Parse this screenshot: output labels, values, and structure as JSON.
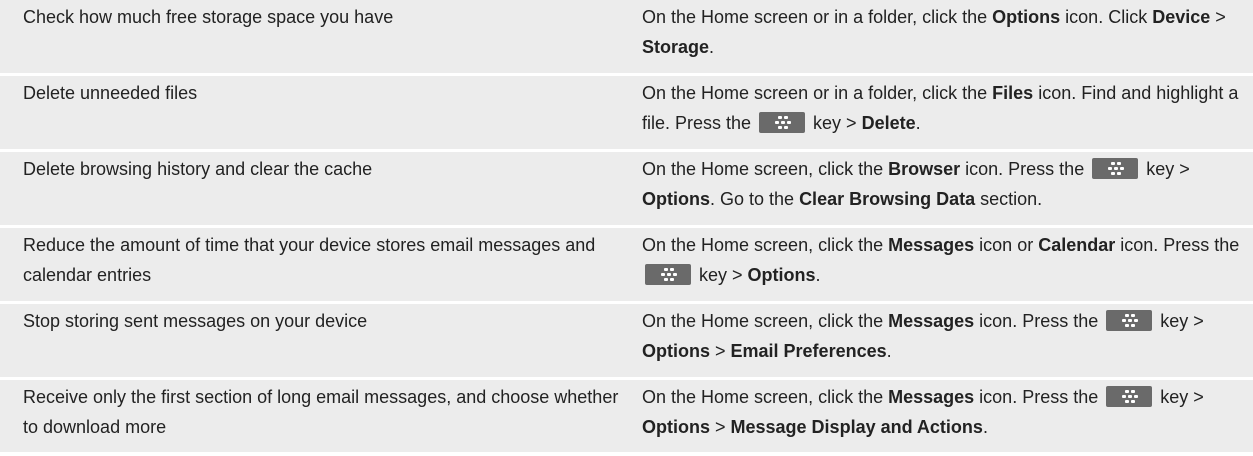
{
  "rows": [
    {
      "task": "Check how much free storage space you have",
      "steps": [
        {
          "t": "On the Home screen or in a folder, click the "
        },
        {
          "b": "Options"
        },
        {
          "t": " icon. Click "
        },
        {
          "b": "Device"
        },
        {
          "t": " > "
        },
        {
          "b": "Storage"
        },
        {
          "t": "."
        }
      ]
    },
    {
      "task": "Delete unneeded files",
      "steps": [
        {
          "t": "On the Home screen or in a folder, click the "
        },
        {
          "b": "Files"
        },
        {
          "t": " icon. Find and highlight a file. Press the "
        },
        {
          "key": "menu-key-icon"
        },
        {
          "t": " key > "
        },
        {
          "b": "Delete"
        },
        {
          "t": "."
        }
      ]
    },
    {
      "task": "Delete browsing history and clear the cache",
      "steps": [
        {
          "t": "On the Home screen, click the "
        },
        {
          "b": "Browser"
        },
        {
          "t": " icon. Press the "
        },
        {
          "key": "menu-key-icon"
        },
        {
          "t": " key > "
        },
        {
          "b": "Options"
        },
        {
          "t": ". Go to the "
        },
        {
          "b": "Clear Browsing Data"
        },
        {
          "t": " section."
        }
      ]
    },
    {
      "task": "Reduce the amount of time that your device stores email messages and calendar entries",
      "steps": [
        {
          "t": "On the Home screen, click the "
        },
        {
          "b": "Messages"
        },
        {
          "t": " icon or "
        },
        {
          "b": "Calendar"
        },
        {
          "t": " icon. Press the "
        },
        {
          "key": "menu-key-icon"
        },
        {
          "t": " key > "
        },
        {
          "b": "Options"
        },
        {
          "t": "."
        }
      ]
    },
    {
      "task": "Stop storing sent messages on your device",
      "steps": [
        {
          "t": "On the Home screen, click the "
        },
        {
          "b": "Messages"
        },
        {
          "t": " icon. Press the "
        },
        {
          "key": "menu-key-icon"
        },
        {
          "t": " key > "
        },
        {
          "b": "Options"
        },
        {
          "t": " > "
        },
        {
          "b": "Email Preferences"
        },
        {
          "t": "."
        }
      ]
    },
    {
      "task": "Receive only the first section of long email messages, and choose whether to download more",
      "steps": [
        {
          "t": "On the Home screen, click the "
        },
        {
          "b": "Messages"
        },
        {
          "t": " icon. Press the "
        },
        {
          "key": "menu-key-icon"
        },
        {
          "t": " key > "
        },
        {
          "b": "Options"
        },
        {
          "t": " > "
        },
        {
          "b": "Message Display and Actions"
        },
        {
          "t": "."
        }
      ]
    }
  ],
  "colors": {
    "row_bg": "#ececec",
    "key_bg": "#6a6a6a",
    "text": "#222222"
  }
}
